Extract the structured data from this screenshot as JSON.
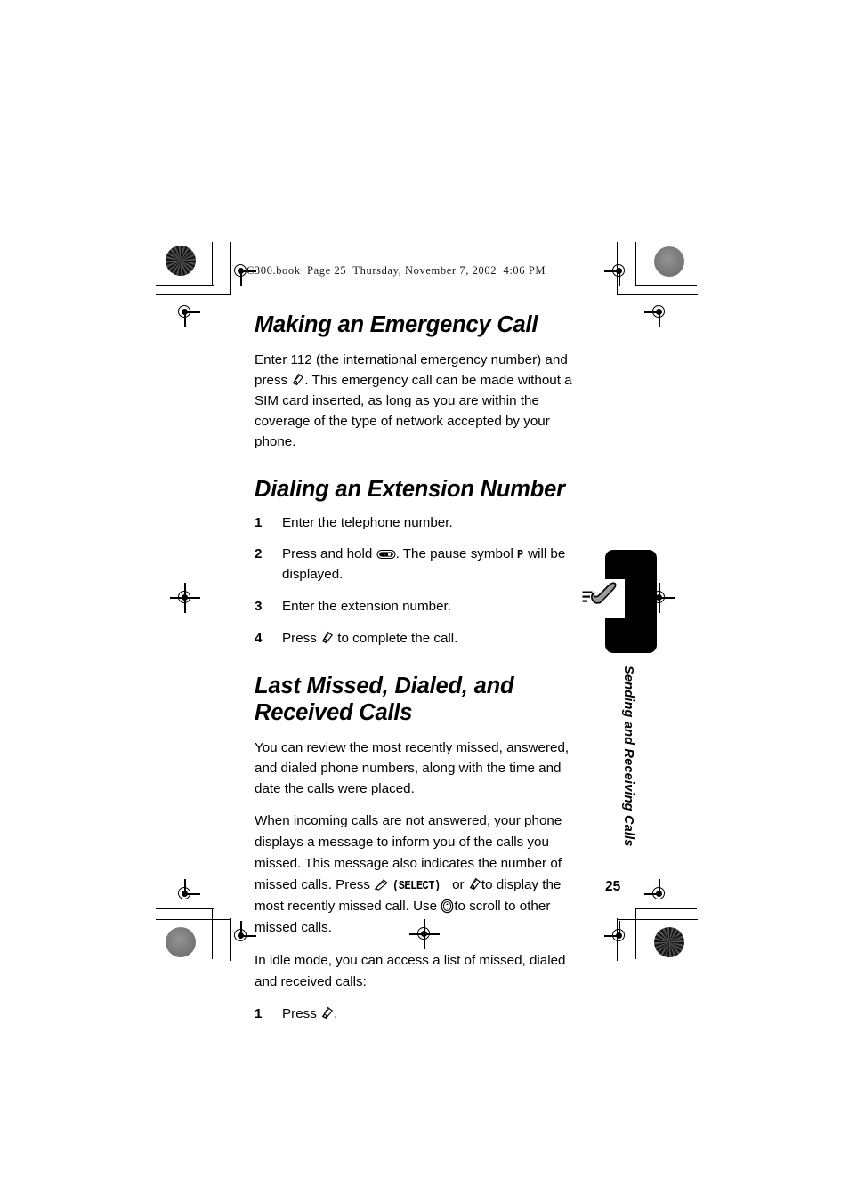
{
  "document": {
    "slug": "C300.book  Page 25  Thursday, November 7, 2002  4:06 PM",
    "page_number": "25"
  },
  "sections": [
    {
      "heading": "Making an Emergency Call",
      "paragraph_before_icon": "Enter 112 (the international emergency number) and press",
      "paragraph_after_icon": ". This emergency call can be made without a SIM card inserted, as long as you are within the coverage of the type of network accepted by your phone."
    },
    {
      "heading": "Dialing an Extension Number",
      "steps": [
        {
          "num": "1",
          "text": "Enter the telephone number."
        },
        {
          "num": "2",
          "text_a": "Press and hold",
          "text_b": ". The pause symbol",
          "pause_symbol": "P",
          "text_c": "will be displayed."
        },
        {
          "num": "3",
          "text": "Enter the extension number."
        },
        {
          "num": "4",
          "text_a": "Press",
          "text_b": "to complete the call."
        }
      ]
    },
    {
      "heading_line1": "Last Missed, Dialed, and",
      "heading_line2": "Received Calls",
      "paragraph1": "You can review the most recently missed, answered, and dialed phone numbers, along with the time and date the calls were placed.",
      "paragraph2_a": "When incoming calls are not answered, your phone displays a message to inform you of the calls you missed. This message also indicates the number of missed calls. Press",
      "select_label": "(SELECT)",
      "paragraph2_b": "or",
      "paragraph2_c": "to display the most recently missed call. Use",
      "paragraph2_d": "to scroll to other missed calls.",
      "paragraph3": "In idle mode, you can access a list of missed, dialed and received calls:",
      "steps": [
        {
          "num": "1",
          "text_a": "Press",
          "text_b": "."
        }
      ]
    }
  ],
  "side_tab": {
    "label": "Sending and Receiving Calls",
    "icon": "phone-handset-icon",
    "background_color": "#000000",
    "icon_color": "#9a9a9a"
  },
  "icons": {
    "send_key": "send-key-icon",
    "star_key": "star-key-icon",
    "soft_key": "soft-key-icon",
    "nav_key": "navigation-key-icon"
  }
}
